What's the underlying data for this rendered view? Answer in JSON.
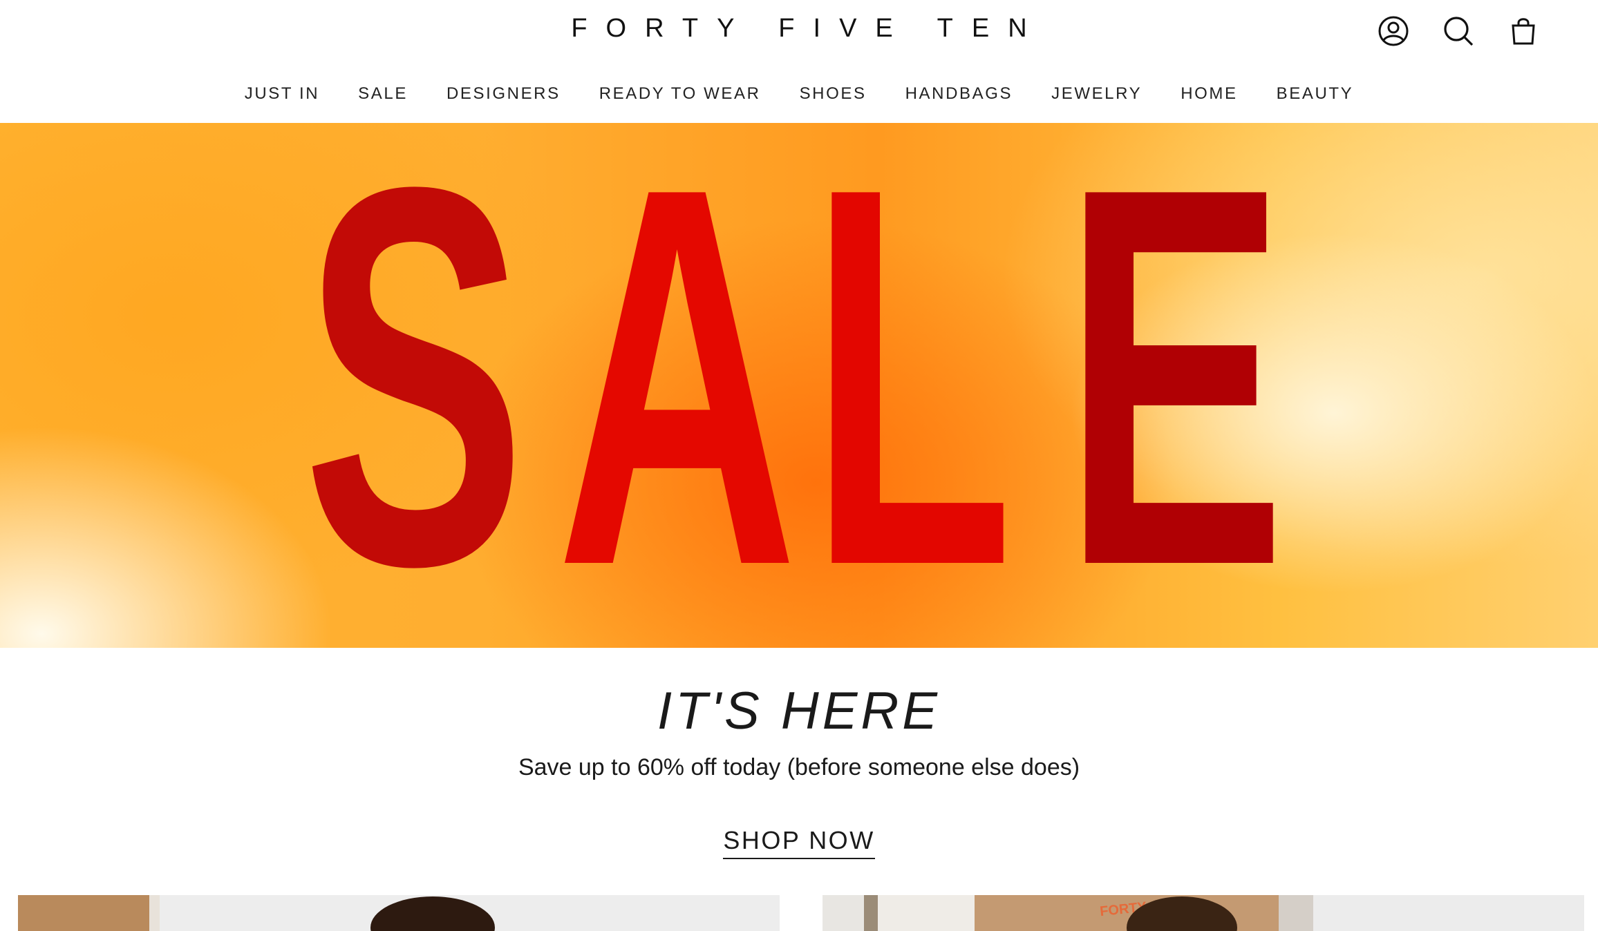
{
  "header": {
    "logo": "FORTY FIVE TEN",
    "icons": [
      "account-icon",
      "search-icon",
      "cart-icon"
    ]
  },
  "nav": {
    "items": [
      "JUST IN",
      "SALE",
      "DESIGNERS",
      "READY TO WEAR",
      "SHOES",
      "HANDBAGS",
      "JEWELRY",
      "HOME",
      "BEAUTY"
    ]
  },
  "hero": {
    "letters": [
      "S",
      "A",
      "L",
      "E"
    ]
  },
  "promo": {
    "title": "IT'S HERE",
    "subtitle": "Save up to 60% off today (before someone else does)",
    "cta": "SHOP NOW"
  },
  "tiles": {
    "right_sign": "FORTY"
  },
  "colors": {
    "sale_red": "#e00a00",
    "hero_orange": "#ff9a20",
    "text": "#1a1a1a"
  }
}
